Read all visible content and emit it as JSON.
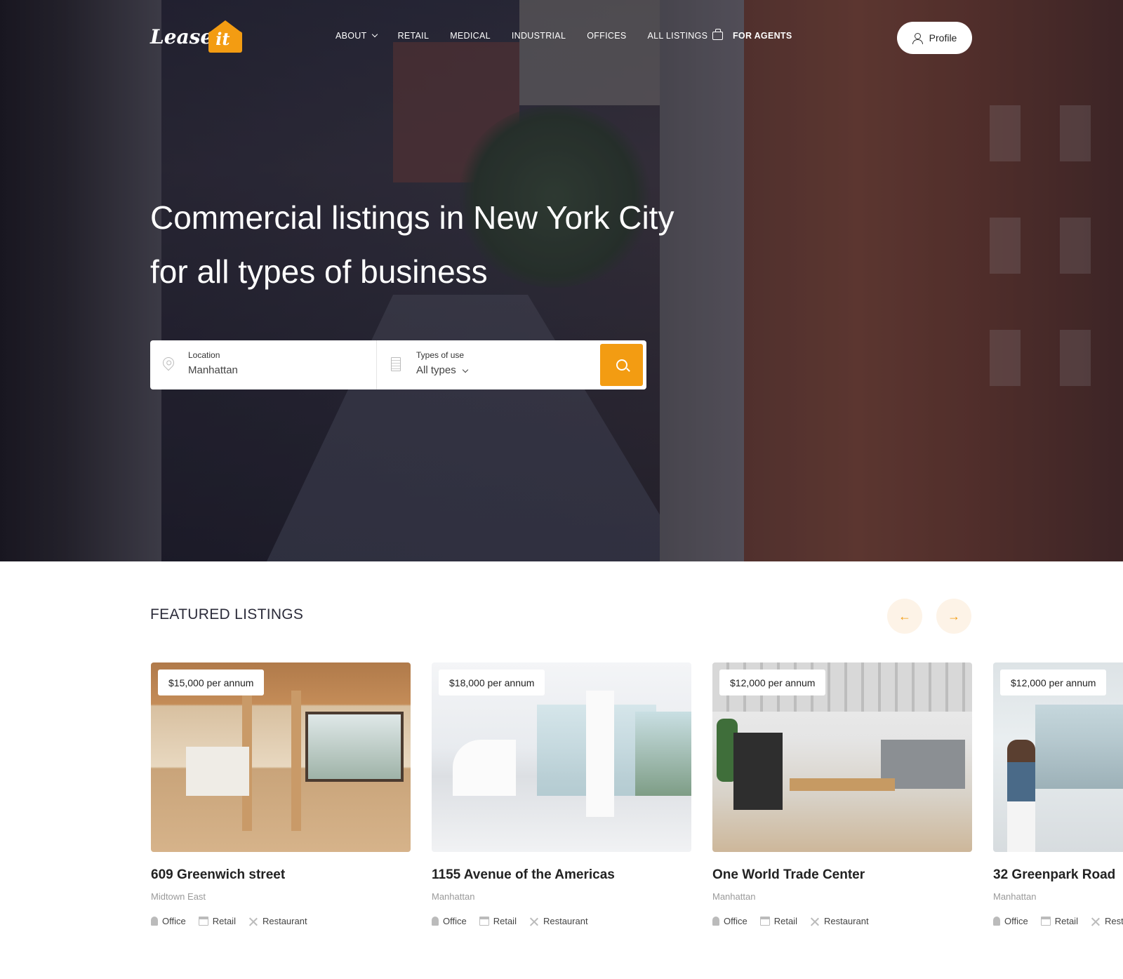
{
  "brand": {
    "logo_text": "Lease",
    "logo_badge": "it",
    "accent": "#f39c12"
  },
  "nav": {
    "items": [
      {
        "label": "ABOUT",
        "has_dropdown": true
      },
      {
        "label": "RETAIL"
      },
      {
        "label": "MEDICAL"
      },
      {
        "label": "INDUSTRIAL"
      },
      {
        "label": "OFFICES"
      },
      {
        "label": "ALL LISTINGS"
      }
    ],
    "agents_label": "FOR AGENTS",
    "agents_icon": "briefcase-icon",
    "profile_label": "Profile",
    "profile_icon": "user-icon"
  },
  "hero": {
    "title_line1": "Commercial listings in New York City",
    "title_line2": "for all types of business"
  },
  "search": {
    "location_label": "Location",
    "location_value": "Manhattan",
    "location_icon": "map-pin-icon",
    "type_label": "Types of use",
    "type_value": "All types",
    "type_icon": "building-icon",
    "button_icon": "search-icon"
  },
  "featured": {
    "title": "FEATURED LISTINGS",
    "prev_icon": "arrow-left-icon",
    "next_icon": "arrow-right-icon",
    "listings": [
      {
        "price": "$15,000 per annum",
        "title": "609 Greenwich street",
        "area": "Midtown East",
        "tags": [
          "Office",
          "Retail",
          "Restaurant"
        ]
      },
      {
        "price": "$18,000 per annum",
        "title": "1155 Avenue of the Americas",
        "area": "Manhattan",
        "tags": [
          "Office",
          "Retail",
          "Restaurant"
        ]
      },
      {
        "price": "$12,000 per annum",
        "title": "One World Trade Center",
        "area": "Manhattan",
        "tags": [
          "Office",
          "Retail",
          "Restaurant"
        ]
      },
      {
        "price": "$12,000 per annum",
        "title": "32 Greenpark Road",
        "area": "Manhattan",
        "tags": [
          "Office",
          "Retail",
          "Restaurant"
        ]
      }
    ]
  }
}
